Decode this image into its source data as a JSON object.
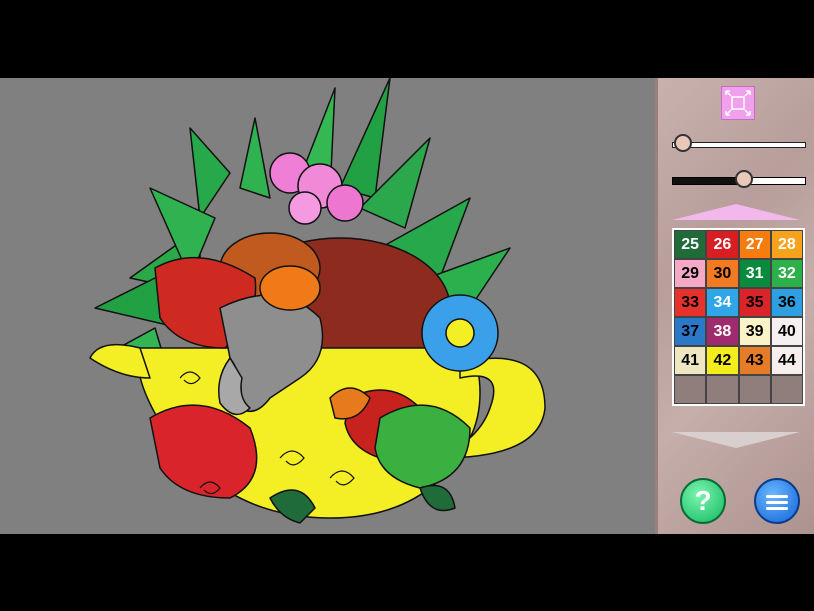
{
  "game": {
    "toolbar": {
      "fit_icon": "fit-to-screen-icon"
    },
    "sliders": {
      "zoom_level": 0.08,
      "brightness_level": 0.54
    },
    "palette": {
      "scroll_up_icon": "palette-scroll-up-icon",
      "scroll_down_icon": "palette-scroll-down-icon",
      "colors": [
        {
          "number": "25",
          "bg": "#1f6b3a",
          "fg": "#ffffff"
        },
        {
          "number": "26",
          "bg": "#d81d23",
          "fg": "#ffffff"
        },
        {
          "number": "27",
          "bg": "#f57c0e",
          "fg": "#ffffff"
        },
        {
          "number": "28",
          "bg": "#f6a21c",
          "fg": "#ffffff"
        },
        {
          "number": "29",
          "bg": "#f5a9c6",
          "fg": "#000000"
        },
        {
          "number": "30",
          "bg": "#f27a22",
          "fg": "#000000"
        },
        {
          "number": "31",
          "bg": "#0a8a3c",
          "fg": "#ffffff"
        },
        {
          "number": "32",
          "bg": "#2bb04a",
          "fg": "#ffffff"
        },
        {
          "number": "33",
          "bg": "#e6322c",
          "fg": "#000000"
        },
        {
          "number": "34",
          "bg": "#2ea6e8",
          "fg": "#ffffff"
        },
        {
          "number": "35",
          "bg": "#d9242a",
          "fg": "#000000"
        },
        {
          "number": "36",
          "bg": "#2e9fe0",
          "fg": "#000000"
        },
        {
          "number": "37",
          "bg": "#2a79c8",
          "fg": "#000000"
        },
        {
          "number": "38",
          "bg": "#a02a6e",
          "fg": "#ffffff"
        },
        {
          "number": "39",
          "bg": "#fbf3c8",
          "fg": "#000000"
        },
        {
          "number": "40",
          "bg": "#f6f1f0",
          "fg": "#000000"
        },
        {
          "number": "41",
          "bg": "#efe7c2",
          "fg": "#000000"
        },
        {
          "number": "42",
          "bg": "#f4ec1c",
          "fg": "#000000"
        },
        {
          "number": "43",
          "bg": "#e77c28",
          "fg": "#000000"
        },
        {
          "number": "44",
          "bg": "#f6efee",
          "fg": "#000000"
        }
      ],
      "empty_slots": 4
    },
    "help_label": "?",
    "menu_icon": "hamburger-menu-icon",
    "artwork": {
      "subject": "teacup-elephant-flowers",
      "background": "#808080"
    }
  }
}
